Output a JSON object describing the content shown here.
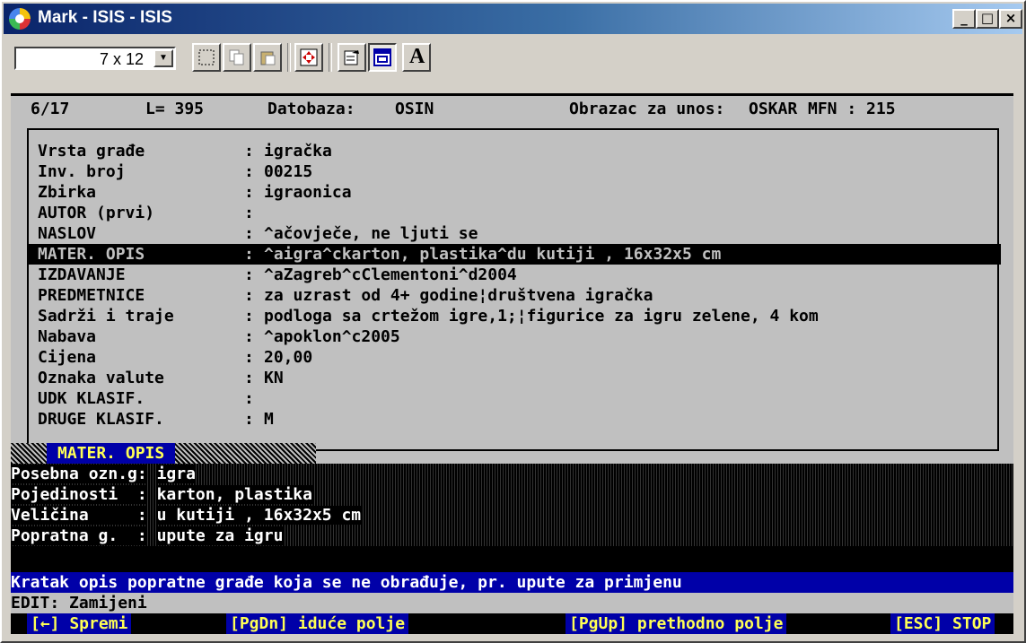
{
  "window": {
    "title": "Mark - ISIS - ISIS",
    "min_label": "_",
    "max_label": "□",
    "close_label": "×"
  },
  "toolbar": {
    "font_size": "7 x 12",
    "dropdown_arrow": "▼",
    "tools": [
      "select-icon",
      "copy-icon",
      "paste-icon",
      "fullscreen-icon",
      "properties-icon",
      "window-icon",
      "font-icon"
    ],
    "font_button_label": "A"
  },
  "console": {
    "status": {
      "record": "6/17",
      "length": "L= 395",
      "db_label": "Datobaza:",
      "db_name": "OSIN",
      "form_label": "Obrazac za unos:",
      "form_name": "OSKAR",
      "mfn": "MFN : 215"
    },
    "fields": [
      {
        "label": "Vrsta građe",
        "value": "igračka"
      },
      {
        "label": "Inv. broj",
        "value": "00215"
      },
      {
        "label": "Zbirka",
        "value": "igraonica"
      },
      {
        "label": "AUTOR (prvi)",
        "value": ""
      },
      {
        "label": "NASLOV",
        "value": "^ačovječe, ne ljuti se"
      },
      {
        "label": "MATER. OPIS",
        "value": "^aigra^ckarton, plastika^du kutiji , 16x32x5 cm"
      },
      {
        "label": "IZDAVANJE",
        "value": "^aZagreb^cClementoni^d2004"
      },
      {
        "label": "PREDMETNICE",
        "value": "za uzrast od 4+ godine¦društvena igračka"
      },
      {
        "label": "Sadrži i traje",
        "value": "podloga sa crtežom igre,1;¦figurice za igru zelene, 4 kom"
      },
      {
        "label": "Nabava",
        "value": "^apoklon^c2005"
      },
      {
        "label": "Cijena",
        "value": "20,00"
      },
      {
        "label": "Oznaka valute",
        "value": "KN"
      },
      {
        "label": "UDK KLASIF.",
        "value": ""
      },
      {
        "label": "DRUGE KLASIF.",
        "value": "M"
      }
    ],
    "colon": ":",
    "subfield_title": "MATER. OPIS",
    "subfields": [
      {
        "label": "Posebna ozn.g:",
        "value": "igra"
      },
      {
        "label": "Pojedinosti  :",
        "value": "karton, plastika"
      },
      {
        "label": "Veličina     :",
        "value": "u kutiji , 16x32x5 cm"
      },
      {
        "label": "Popratna g.  :",
        "value": "upute za igru"
      }
    ],
    "help_text": "Kratak opis popratne građe koja se ne obrađuje, pr. upute za primjenu",
    "edit_mode": "EDIT: Zamijeni",
    "keys": {
      "save": "[←] Spremi",
      "next": "[PgDn] iduće polje",
      "prev": "[PgUp] prethodno polje",
      "stop": "[ESC] STOP"
    }
  }
}
